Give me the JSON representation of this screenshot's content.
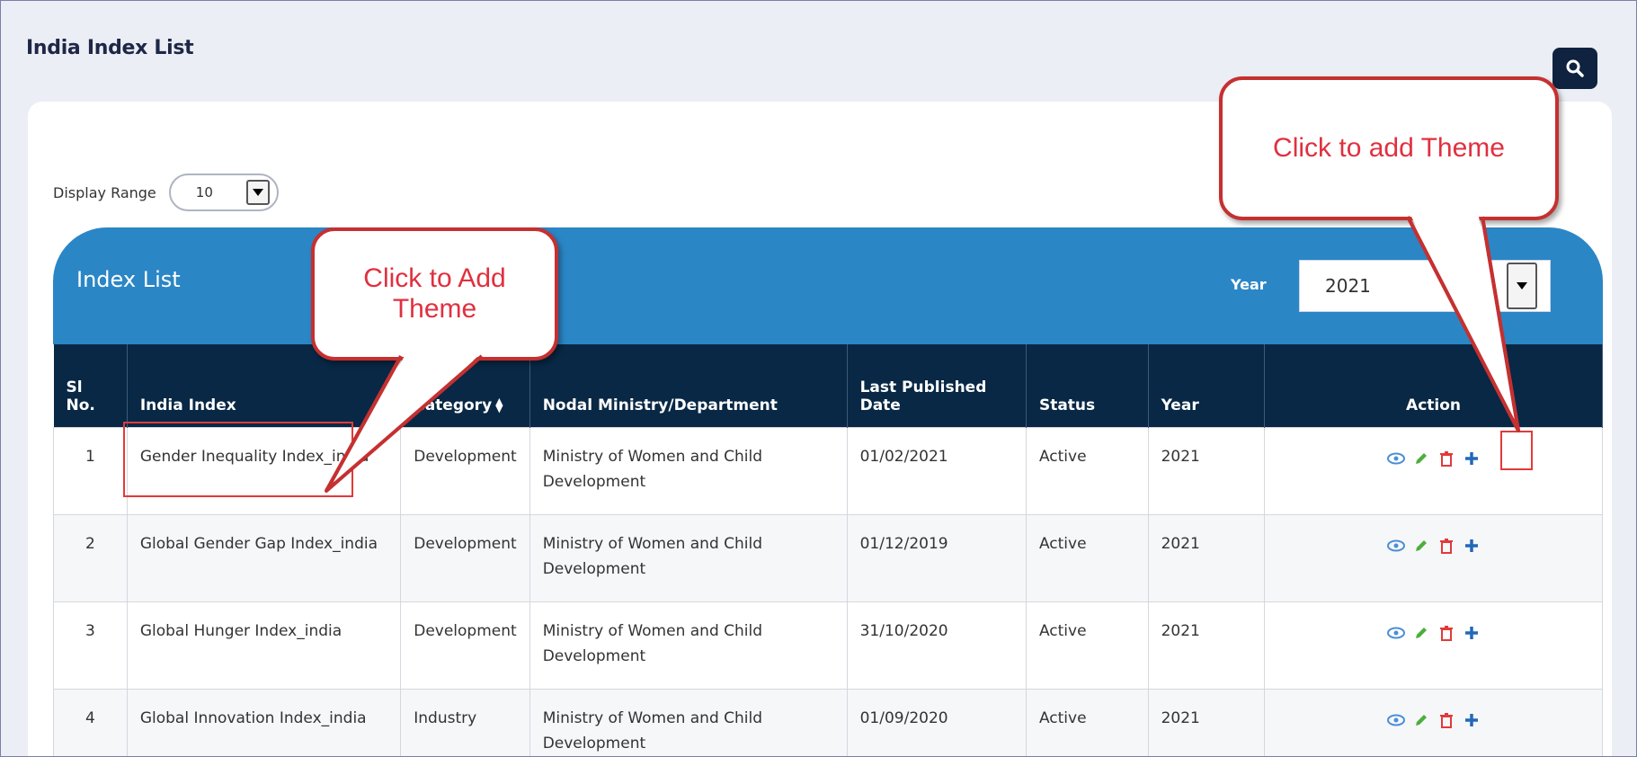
{
  "page": {
    "title": "India Index List"
  },
  "display_range": {
    "label": "Display Range",
    "value": "10"
  },
  "panel": {
    "title": "Index List",
    "year_label": "Year",
    "year_value": "2021"
  },
  "table": {
    "headers": {
      "sl_no": "Sl No.",
      "india_index": "India Index",
      "category": "Category",
      "nodal": "Nodal Ministry/Department",
      "last_published": "Last Published Date",
      "status": "Status",
      "year": "Year",
      "action": "Action"
    },
    "rows": [
      {
        "sl": "1",
        "index": "Gender Inequality Index_india",
        "category": "Development",
        "nodal": "Ministry of Women and Child Development",
        "date": "01/02/2021",
        "status": "Active",
        "year": "2021"
      },
      {
        "sl": "2",
        "index": "Global Gender Gap Index_india",
        "category": "Development",
        "nodal": "Ministry of Women and Child Development",
        "date": "01/12/2019",
        "status": "Active",
        "year": "2021"
      },
      {
        "sl": "3",
        "index": "Global Hunger Index_india",
        "category": "Development",
        "nodal": "Ministry of Women and Child Development",
        "date": "31/10/2020",
        "status": "Active",
        "year": "2021"
      },
      {
        "sl": "4",
        "index": "Global Innovation Index_india",
        "category": "Industry",
        "nodal": "Ministry of Women and Child Development",
        "date": "01/09/2020",
        "status": "Active",
        "year": "2021"
      }
    ],
    "action_icons": [
      "eye-icon",
      "pencil-icon",
      "trash-icon",
      "plus-icon"
    ]
  },
  "callouts": {
    "left": "Click to Add Theme",
    "right": "Click to add Theme"
  },
  "colors": {
    "header_bg": "#082845",
    "panel_bg": "#2b86c6",
    "link": "#2b6fb8",
    "active": "#2f9a2f",
    "callout": "#e0303f"
  }
}
